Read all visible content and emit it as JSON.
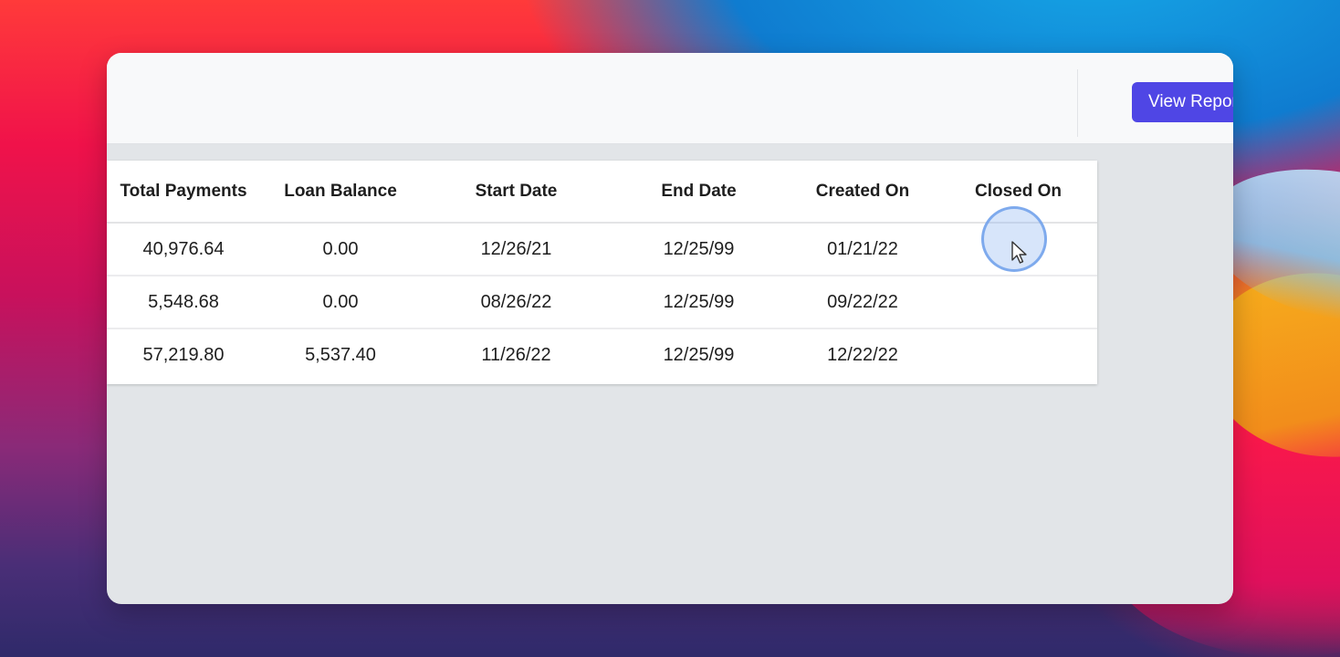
{
  "header": {
    "view_report_label": "View Report"
  },
  "table": {
    "columns": [
      "Total Payments",
      "Loan Balance",
      "Start Date",
      "End Date",
      "Created On",
      "Closed On"
    ],
    "rows": [
      [
        "40,976.64",
        "0.00",
        "12/26/21",
        "12/25/99",
        "01/21/22",
        ""
      ],
      [
        "5,548.68",
        "0.00",
        "08/26/22",
        "12/25/99",
        "09/22/22",
        ""
      ],
      [
        "57,219.80",
        "5,537.40",
        "11/26/22",
        "12/25/99",
        "12/22/22",
        ""
      ]
    ]
  },
  "colors": {
    "accent": "#4f46e5",
    "window_bg": "#e2e5e8",
    "topbar_bg": "#f8f9fa"
  },
  "icons": {
    "cursor": "mouse-pointer-icon"
  }
}
